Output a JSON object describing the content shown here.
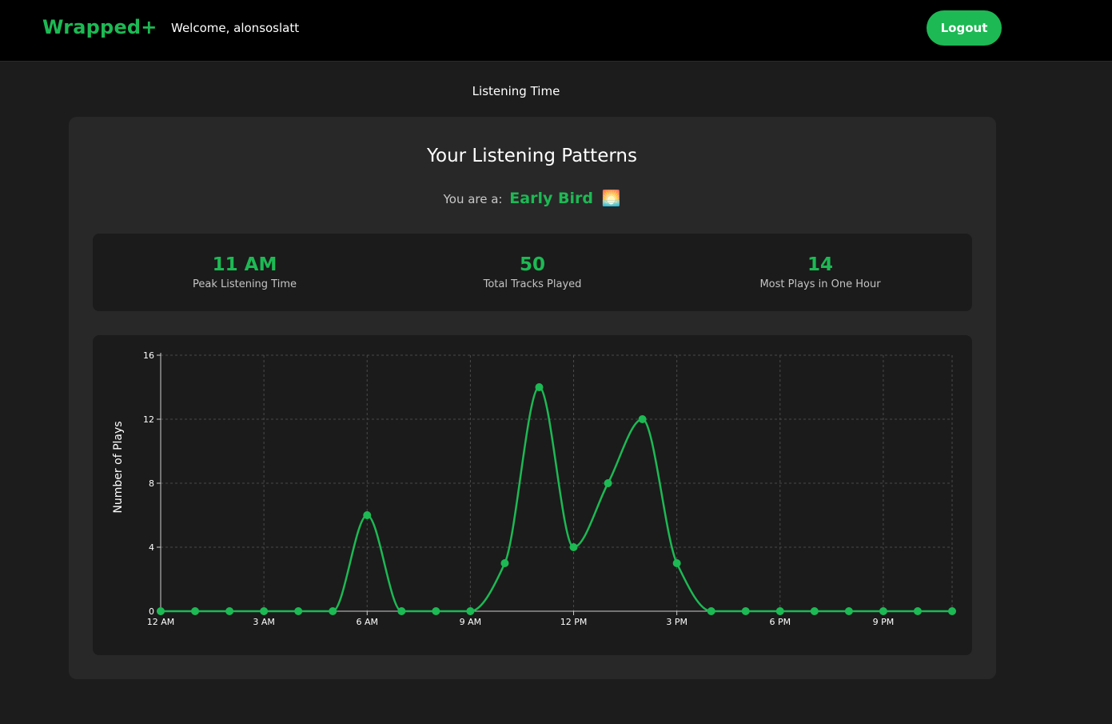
{
  "nav": {
    "logo": "Wrapped+",
    "welcome": "Welcome, alonsoslatt",
    "logout_label": "Logout"
  },
  "section_label": "Listening Time",
  "card": {
    "title": "Your Listening Patterns",
    "persona_prefix": "You are a:",
    "persona_type": "Early Bird",
    "persona_emoji": "🌅"
  },
  "stats": [
    {
      "value": "11 AM",
      "label": "Peak Listening Time"
    },
    {
      "value": "50",
      "label": "Total Tracks Played"
    },
    {
      "value": "14",
      "label": "Most Plays in One Hour"
    }
  ],
  "colors": {
    "accent": "#1db954",
    "background": "#1c1c1c",
    "card": "#282828",
    "panel": "#1b1b1b"
  },
  "chart_data": {
    "type": "line",
    "title": "",
    "xlabel": "",
    "ylabel": "Number of Plays",
    "x": [
      0,
      1,
      2,
      3,
      4,
      5,
      6,
      7,
      8,
      9,
      10,
      11,
      12,
      13,
      14,
      15,
      16,
      17,
      18,
      19,
      20,
      21,
      22,
      23
    ],
    "x_tick_labels": [
      "12 AM",
      "3 AM",
      "6 AM",
      "9 AM",
      "12 PM",
      "3 PM",
      "6 PM",
      "9 PM"
    ],
    "x_tick_values": [
      0,
      3,
      6,
      9,
      12,
      15,
      18,
      21
    ],
    "values": [
      0,
      0,
      0,
      0,
      0,
      0,
      6,
      0,
      0,
      0,
      3,
      14,
      4,
      8,
      12,
      3,
      0,
      0,
      0,
      0,
      0,
      0,
      0,
      0
    ],
    "y_ticks": [
      0,
      4,
      8,
      12,
      16
    ],
    "ylim": [
      0,
      16
    ],
    "xlim": [
      0,
      23
    ],
    "grid": true,
    "smooth": true
  }
}
